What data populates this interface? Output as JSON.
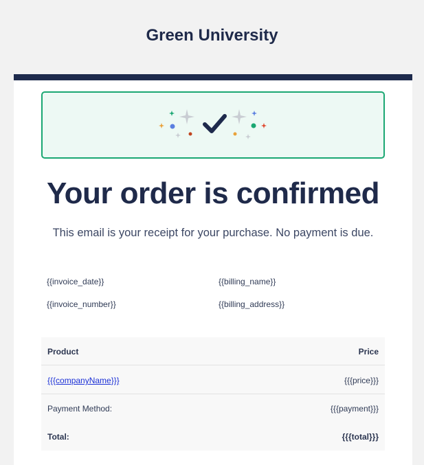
{
  "header": {
    "brand": "Green University"
  },
  "banner": {
    "icon": "checkmark-sparkles-icon",
    "accent": "#1aa772",
    "background": "#edf9f4"
  },
  "main": {
    "headline": "Your order is confirmed",
    "subtext": "This email is your receipt for your purchase. No payment is due."
  },
  "details": {
    "invoice_date": "{{invoice_date}}",
    "invoice_number": "{{invoice_number}}",
    "billing_name": "{{billing_name}}",
    "billing_address": "{{billing_address}}"
  },
  "table": {
    "col_product": "Product",
    "col_price": "Price",
    "item_name": "{{{companyName}}}",
    "item_price": "{{{price}}}",
    "payment_label": "Payment Method:",
    "payment_value": "{{{payment}}}",
    "total_label": "Total:",
    "total_value": "{{{total}}}"
  },
  "colors": {
    "navy": "#1e2a4c",
    "page_bg": "#f2f2f2",
    "link": "#1a2fd6"
  }
}
